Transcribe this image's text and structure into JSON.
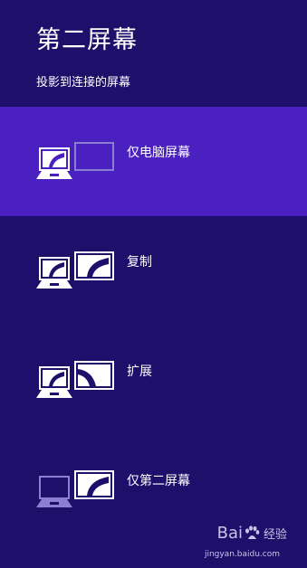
{
  "header": {
    "title": "第二屏幕",
    "subtitle": "投影到连接的屏幕"
  },
  "options": [
    {
      "label": "仅电脑屏幕",
      "icon": "pc-screen-only-icon",
      "selected": true
    },
    {
      "label": "复制",
      "icon": "duplicate-icon",
      "selected": false
    },
    {
      "label": "扩展",
      "icon": "extend-icon",
      "selected": false
    },
    {
      "label": "仅第二屏幕",
      "icon": "second-screen-only-icon",
      "selected": false
    }
  ],
  "watermark": {
    "brand_left": "Bai",
    "brand_right": "经验",
    "url": "jingyan.baidu.com"
  },
  "colors": {
    "background": "#1e0f6b",
    "selected": "#4b20c0",
    "text": "#ffffff",
    "dim_screen": "#8a7fd0"
  }
}
